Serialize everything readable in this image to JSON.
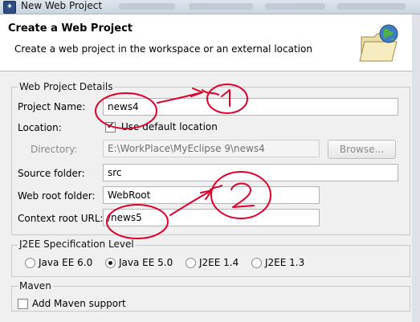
{
  "window": {
    "title": "New Web Project"
  },
  "banner": {
    "heading": "Create a Web Project",
    "description": "Create a web project in the workspace or an external location",
    "icon": "globe-folder-icon"
  },
  "details": {
    "group_title": "Web Project Details",
    "project_name_label": "Project Name:",
    "project_name_value": "news4",
    "location_label": "Location:",
    "use_default_location_label": "Use default location",
    "use_default_location_checked": true,
    "directory_label": "Directory:",
    "directory_value": "E:\\WorkPlace\\MyEclipse 9\\news4",
    "browse_label": "Browse...",
    "source_folder_label": "Source folder:",
    "source_folder_value": "src",
    "web_root_label": "Web root folder:",
    "web_root_value": "WebRoot",
    "context_root_label": "Context root URL:",
    "context_root_value": "/news5"
  },
  "j2ee": {
    "group_title": "J2EE Specification Level",
    "options": [
      {
        "label": "Java EE 6.0",
        "selected": false
      },
      {
        "label": "Java EE 5.0",
        "selected": true
      },
      {
        "label": "J2EE 1.4",
        "selected": false
      },
      {
        "label": "J2EE 1.3",
        "selected": false
      }
    ]
  },
  "maven": {
    "group_title": "Maven",
    "add_support_label": "Add Maven support",
    "add_support_checked": false
  },
  "annotations": {
    "color": "#e0002a",
    "marks": [
      "1",
      "2"
    ]
  }
}
